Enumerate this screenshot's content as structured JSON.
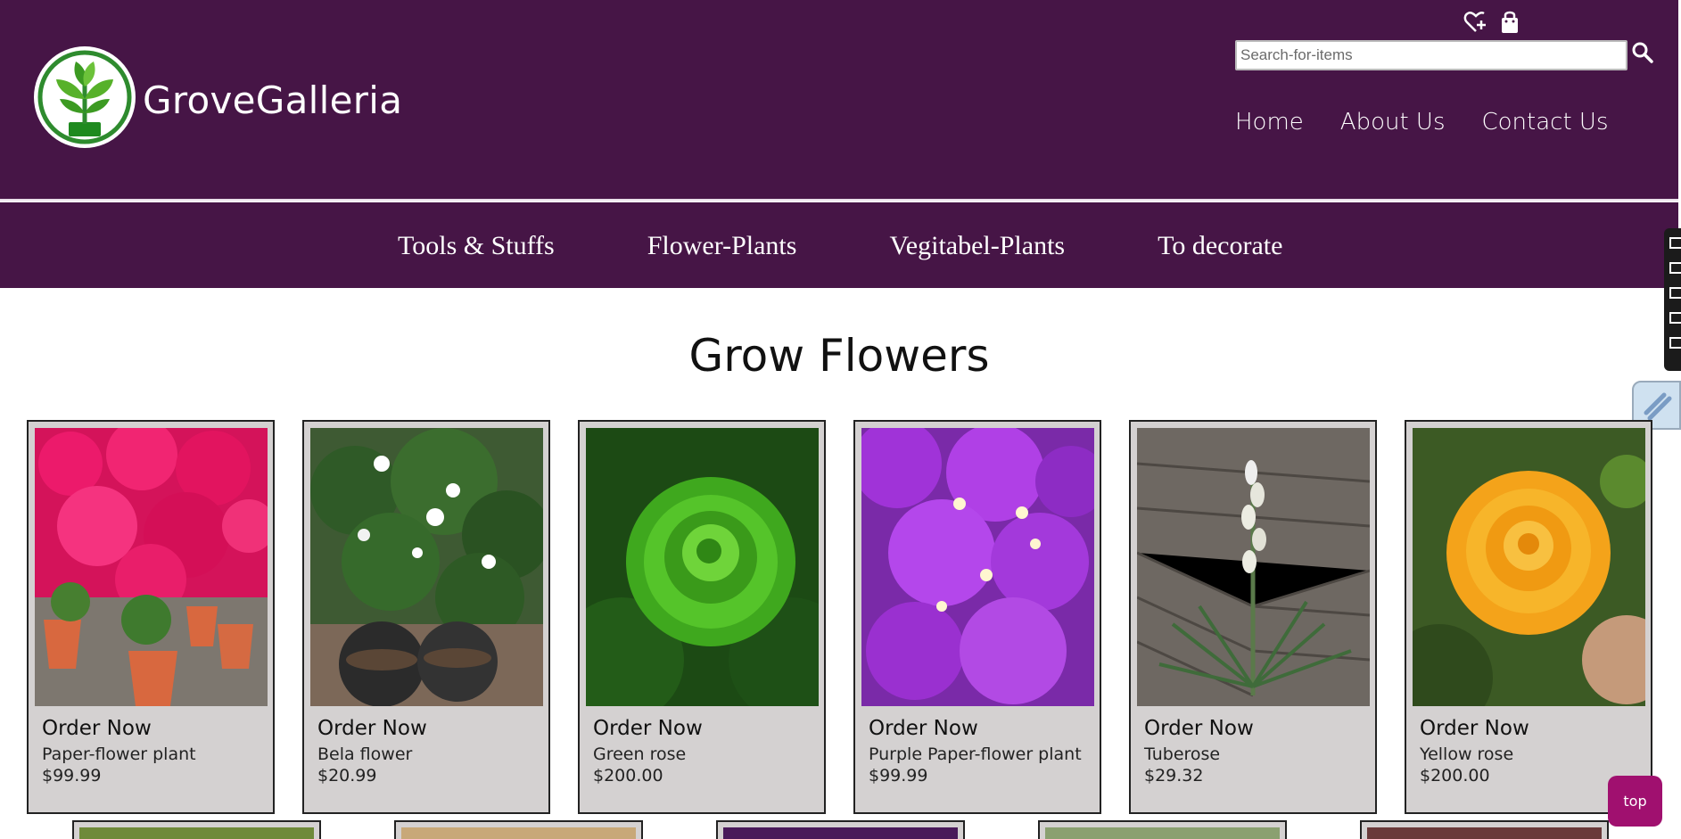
{
  "brand": {
    "name": "GroveGalleria"
  },
  "header_icons": [
    "heart-plus-icon",
    "shopping-bag-icon"
  ],
  "search": {
    "placeholder": "Search-for-items",
    "value": ""
  },
  "top_nav": [
    "Home",
    "About Us",
    "Contact Us"
  ],
  "category_nav": [
    "Tools & Stuffs",
    "Flower-Plants",
    "Vegitabel-Plants",
    "To decorate"
  ],
  "section_title": "Grow Flowers",
  "products": [
    {
      "action": "Order Now",
      "name": "Paper-flower plant",
      "price": "$99.99"
    },
    {
      "action": "Order Now",
      "name": "Bela flower",
      "price": "$20.99"
    },
    {
      "action": "Order Now",
      "name": "Green rose",
      "price": "$200.00"
    },
    {
      "action": "Order Now",
      "name": "Purple Paper-flower plant",
      "price": "$99.99"
    },
    {
      "action": "Order Now",
      "name": "Tuberose",
      "price": "$29.32"
    },
    {
      "action": "Order Now",
      "name": "Yellow rose",
      "price": "$200.00"
    }
  ],
  "top_button": "top",
  "colors": {
    "header_bg": "#461546",
    "card_bg": "#d4d1d1",
    "top_button_bg": "#a0106f"
  }
}
